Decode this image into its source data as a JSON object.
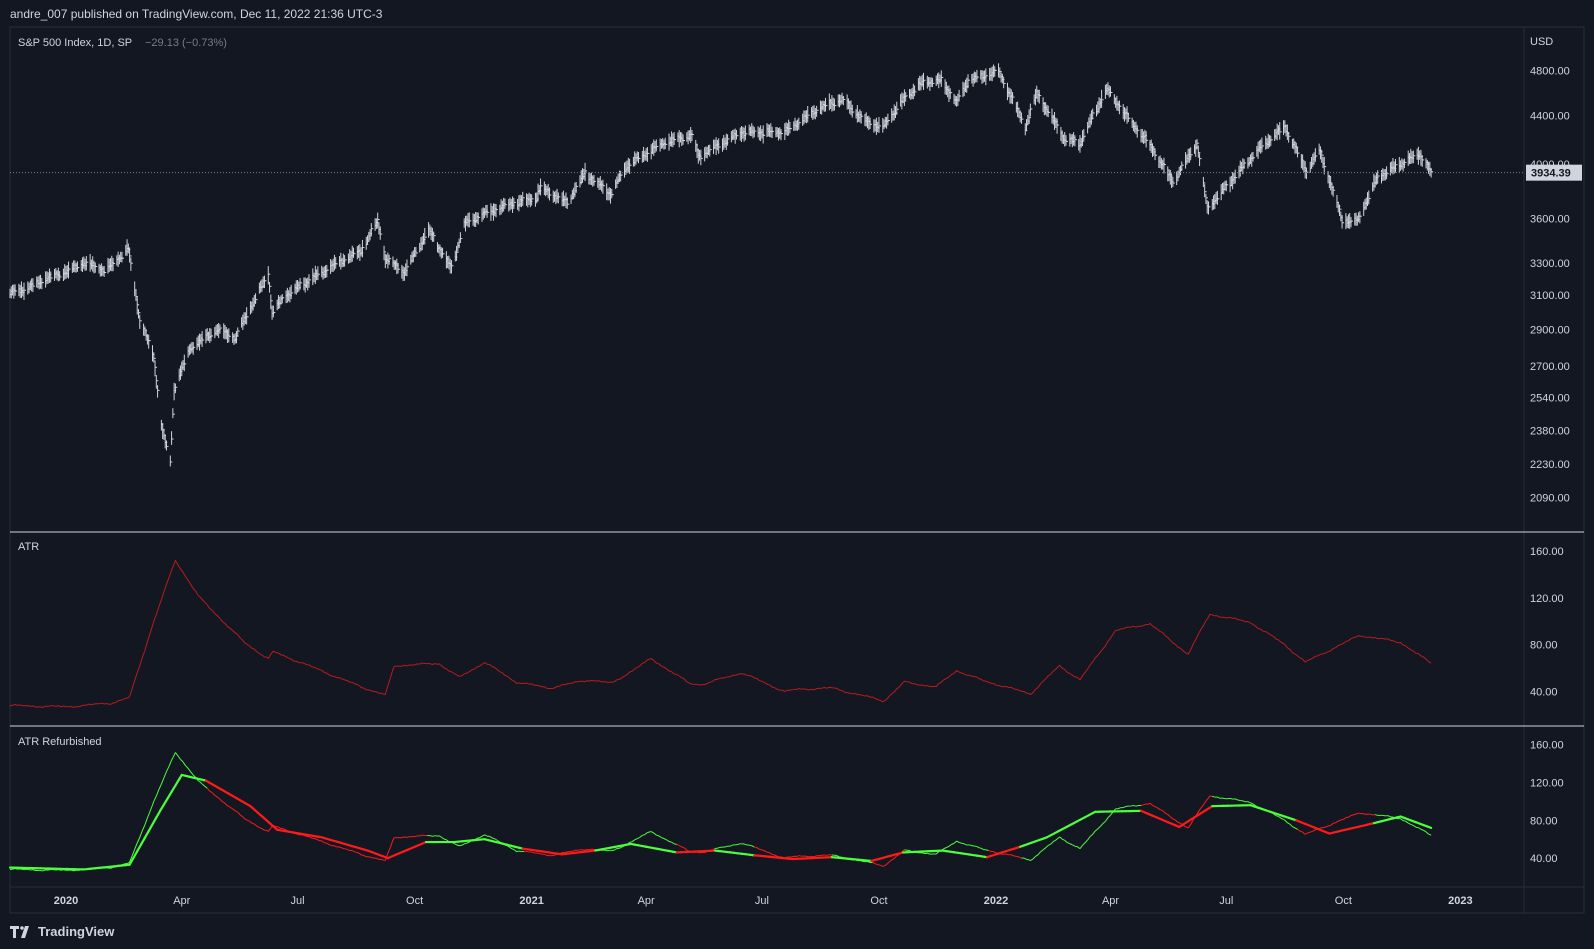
{
  "header": {
    "published": "andre_007 published on TradingView.com, Dec 11, 2022 21:36 UTC-3"
  },
  "footer": {
    "brand": "TradingView"
  },
  "colors": {
    "bg": "#131722",
    "price": "#d1d4dc",
    "atr": "#b71c1c",
    "up": "#4cff3c",
    "down": "#ff1a1a"
  },
  "chart_data": [
    {
      "type": "line",
      "title": "S&P 500 Index, 1D, SP",
      "change": "−29.13 (−0.73%)",
      "currency": "USD",
      "last_value": "3934.39",
      "ylim": [
        2000,
        4900
      ],
      "log_scale": true,
      "y_ticks": [
        "4800.00",
        "4400.00",
        "4000.00",
        "3600.00",
        "3300.00",
        "3100.00",
        "2900.00",
        "2700.00",
        "2540.00",
        "2380.00",
        "2230.00",
        "2090.00"
      ],
      "series": [
        {
          "x": [
            "2019-11-18",
            "2019-12-02",
            "2019-12-16",
            "2020-01-02",
            "2020-01-15",
            "2020-02-01",
            "2020-02-19",
            "2020-02-28",
            "2020-03-10",
            "2020-03-16",
            "2020-03-23",
            "2020-03-26",
            "2020-04-08",
            "2020-04-29",
            "2020-05-13",
            "2020-06-08",
            "2020-06-11",
            "2020-06-22",
            "2020-07-10",
            "2020-08-01",
            "2020-08-20",
            "2020-09-02",
            "2020-09-08",
            "2020-09-23",
            "2020-10-12",
            "2020-10-30",
            "2020-11-09",
            "2020-11-24",
            "2020-12-15",
            "2021-01-04",
            "2021-01-08",
            "2021-01-29",
            "2021-02-12",
            "2021-03-04",
            "2021-03-17",
            "2021-04-15",
            "2021-05-07",
            "2021-05-12",
            "2021-06-15",
            "2021-07-19",
            "2021-08-15",
            "2021-09-02",
            "2021-09-20",
            "2021-10-04",
            "2021-10-21",
            "2021-11-05",
            "2021-11-19",
            "2021-12-01",
            "2021-12-10",
            "2022-01-03",
            "2022-01-24",
            "2022-02-02",
            "2022-02-24",
            "2022-03-08",
            "2022-03-29",
            "2022-04-15",
            "2022-05-02",
            "2022-05-20",
            "2022-06-08",
            "2022-06-16",
            "2022-07-01",
            "2022-07-29",
            "2022-08-16",
            "2022-09-02",
            "2022-09-12",
            "2022-09-30",
            "2022-10-12",
            "2022-10-28",
            "2022-11-15",
            "2022-11-30",
            "2022-12-09"
          ],
          "y": [
            3110,
            3140,
            3200,
            3245,
            3300,
            3250,
            3390,
            2950,
            2750,
            2400,
            2237,
            2580,
            2800,
            2900,
            2850,
            3230,
            3000,
            3100,
            3190,
            3300,
            3380,
            3580,
            3330,
            3240,
            3520,
            3260,
            3560,
            3630,
            3700,
            3740,
            3820,
            3710,
            3930,
            3770,
            3990,
            4170,
            4230,
            4060,
            4255,
            4260,
            4460,
            4540,
            4350,
            4300,
            4550,
            4700,
            4710,
            4510,
            4710,
            4796,
            4300,
            4590,
            4200,
            4170,
            4630,
            4370,
            4150,
            3860,
            4160,
            3666,
            3830,
            4140,
            4300,
            3940,
            4110,
            3585,
            3577,
            3900,
            4000,
            4080,
            3934
          ]
        }
      ]
    },
    {
      "type": "line",
      "title": "ATR",
      "ylim": [
        20,
        165
      ],
      "y_ticks": [
        "160.00",
        "120.00",
        "80.00",
        "40.00"
      ],
      "series": [
        {
          "x": [
            "2019-11-18",
            "2020-01-01",
            "2020-02-05",
            "2020-02-20",
            "2020-03-10",
            "2020-03-27",
            "2020-04-15",
            "2020-05-20",
            "2020-06-08",
            "2020-06-12",
            "2020-07-10",
            "2020-08-20",
            "2020-09-08",
            "2020-09-15",
            "2020-10-20",
            "2020-11-05",
            "2020-11-25",
            "2020-12-20",
            "2021-01-15",
            "2021-02-15",
            "2021-03-05",
            "2021-04-05",
            "2021-05-05",
            "2021-05-15",
            "2021-06-15",
            "2021-07-19",
            "2021-07-30",
            "2021-08-25",
            "2021-10-05",
            "2021-10-21",
            "2021-11-15",
            "2021-12-01",
            "2021-12-20",
            "2022-01-28",
            "2022-02-20",
            "2022-03-08",
            "2022-04-05",
            "2022-05-02",
            "2022-05-20",
            "2022-06-01",
            "2022-06-18",
            "2022-07-20",
            "2022-08-16",
            "2022-09-01",
            "2022-10-14",
            "2022-11-15",
            "2022-12-09"
          ],
          "values": [
            28,
            27,
            30,
            35,
            100,
            152,
            120,
            82,
            68,
            74,
            62,
            44,
            37,
            62,
            64,
            52,
            65,
            48,
            43,
            50,
            47,
            68,
            47,
            46,
            56,
            40,
            42,
            43,
            32,
            48,
            44,
            58,
            50,
            38,
            62,
            50,
            92,
            98,
            82,
            72,
            106,
            99,
            80,
            65,
            88,
            82,
            64
          ]
        }
      ]
    },
    {
      "type": "line",
      "title": "ATR Refurbished",
      "ylim": [
        20,
        165
      ],
      "y_ticks": [
        "160.00",
        "120.00",
        "80.00",
        "40.00"
      ],
      "series": [
        {
          "name": "",
          "x": [
            "2019-11-18",
            "2020-01-01",
            "2020-02-05",
            "2020-02-20",
            "2020-03-10",
            "2020-03-27",
            "2020-04-15",
            "2020-05-20",
            "2020-06-08",
            "2020-06-12",
            "2020-07-10",
            "2020-08-20",
            "2020-09-08",
            "2020-09-15",
            "2020-10-20",
            "2020-11-05",
            "2020-11-25",
            "2020-12-20",
            "2021-01-15",
            "2021-02-15",
            "2021-03-05",
            "2021-04-05",
            "2021-05-05",
            "2021-05-15",
            "2021-06-15",
            "2021-07-19",
            "2021-07-30",
            "2021-08-25",
            "2021-10-05",
            "2021-10-21",
            "2021-11-15",
            "2021-12-01",
            "2021-12-20",
            "2022-01-28",
            "2022-02-20",
            "2022-03-08",
            "2022-04-05",
            "2022-05-02",
            "2022-05-20",
            "2022-06-01",
            "2022-06-18",
            "2022-07-20",
            "2022-08-16",
            "2022-09-01",
            "2022-10-14",
            "2022-11-15",
            "2022-12-09"
          ],
          "values": [
            28,
            27,
            30,
            35,
            100,
            152,
            120,
            82,
            68,
            74,
            62,
            44,
            37,
            62,
            64,
            52,
            65,
            48,
            43,
            50,
            47,
            68,
            47,
            46,
            56,
            40,
            42,
            43,
            32,
            48,
            44,
            58,
            50,
            38,
            62,
            50,
            92,
            98,
            82,
            72,
            106,
            99,
            80,
            65,
            88,
            82,
            64
          ]
        },
        {
          "name": "",
          "x": [
            "2019-11-18",
            "2020-01-15",
            "2020-02-20",
            "2020-03-15",
            "2020-04-01",
            "2020-04-20",
            "2020-05-25",
            "2020-06-15",
            "2020-07-20",
            "2020-08-25",
            "2020-09-10",
            "2020-10-10",
            "2020-11-01",
            "2020-11-25",
            "2020-12-25",
            "2021-01-25",
            "2021-02-20",
            "2021-03-20",
            "2021-04-25",
            "2021-05-25",
            "2021-06-25",
            "2021-07-25",
            "2021-08-25",
            "2021-09-25",
            "2021-10-20",
            "2021-11-20",
            "2021-12-25",
            "2022-01-20",
            "2022-02-10",
            "2022-03-20",
            "2022-04-25",
            "2022-05-25",
            "2022-06-20",
            "2022-07-20",
            "2022-08-25",
            "2022-09-20",
            "2022-10-25",
            "2022-11-15",
            "2022-12-09"
          ],
          "values": [
            30,
            28,
            33,
            90,
            128,
            122,
            95,
            70,
            62,
            48,
            40,
            57,
            57,
            60,
            50,
            44,
            48,
            55,
            46,
            48,
            43,
            39,
            41,
            37,
            46,
            48,
            41,
            52,
            62,
            89,
            90,
            73,
            95,
            96,
            80,
            66,
            77,
            84,
            72
          ],
          "trend": [
            "u",
            "u",
            "u",
            "u",
            "u",
            "d",
            "d",
            "d",
            "d",
            "d",
            "d",
            "u",
            "u",
            "u",
            "d",
            "d",
            "u",
            "u",
            "d",
            "u",
            "d",
            "d",
            "u",
            "d",
            "u",
            "u",
            "d",
            "u",
            "u",
            "u",
            "d",
            "d",
            "u",
            "u",
            "d",
            "d",
            "u",
            "u",
            "d"
          ]
        }
      ]
    }
  ],
  "x_axis": {
    "ticks": [
      {
        "date": "2020-01-01",
        "label": "2020",
        "bold": true
      },
      {
        "date": "2020-04-01",
        "label": "Apr",
        "bold": false
      },
      {
        "date": "2020-07-01",
        "label": "Jul",
        "bold": false
      },
      {
        "date": "2020-10-01",
        "label": "Oct",
        "bold": false
      },
      {
        "date": "2021-01-01",
        "label": "2021",
        "bold": true
      },
      {
        "date": "2021-04-01",
        "label": "Apr",
        "bold": false
      },
      {
        "date": "2021-07-01",
        "label": "Jul",
        "bold": false
      },
      {
        "date": "2021-10-01",
        "label": "Oct",
        "bold": false
      },
      {
        "date": "2022-01-01",
        "label": "2022",
        "bold": true
      },
      {
        "date": "2022-04-01",
        "label": "Apr",
        "bold": false
      },
      {
        "date": "2022-07-01",
        "label": "Jul",
        "bold": false
      },
      {
        "date": "2022-10-01",
        "label": "Oct",
        "bold": false
      },
      {
        "date": "2023-01-01",
        "label": "2023",
        "bold": true
      }
    ]
  }
}
